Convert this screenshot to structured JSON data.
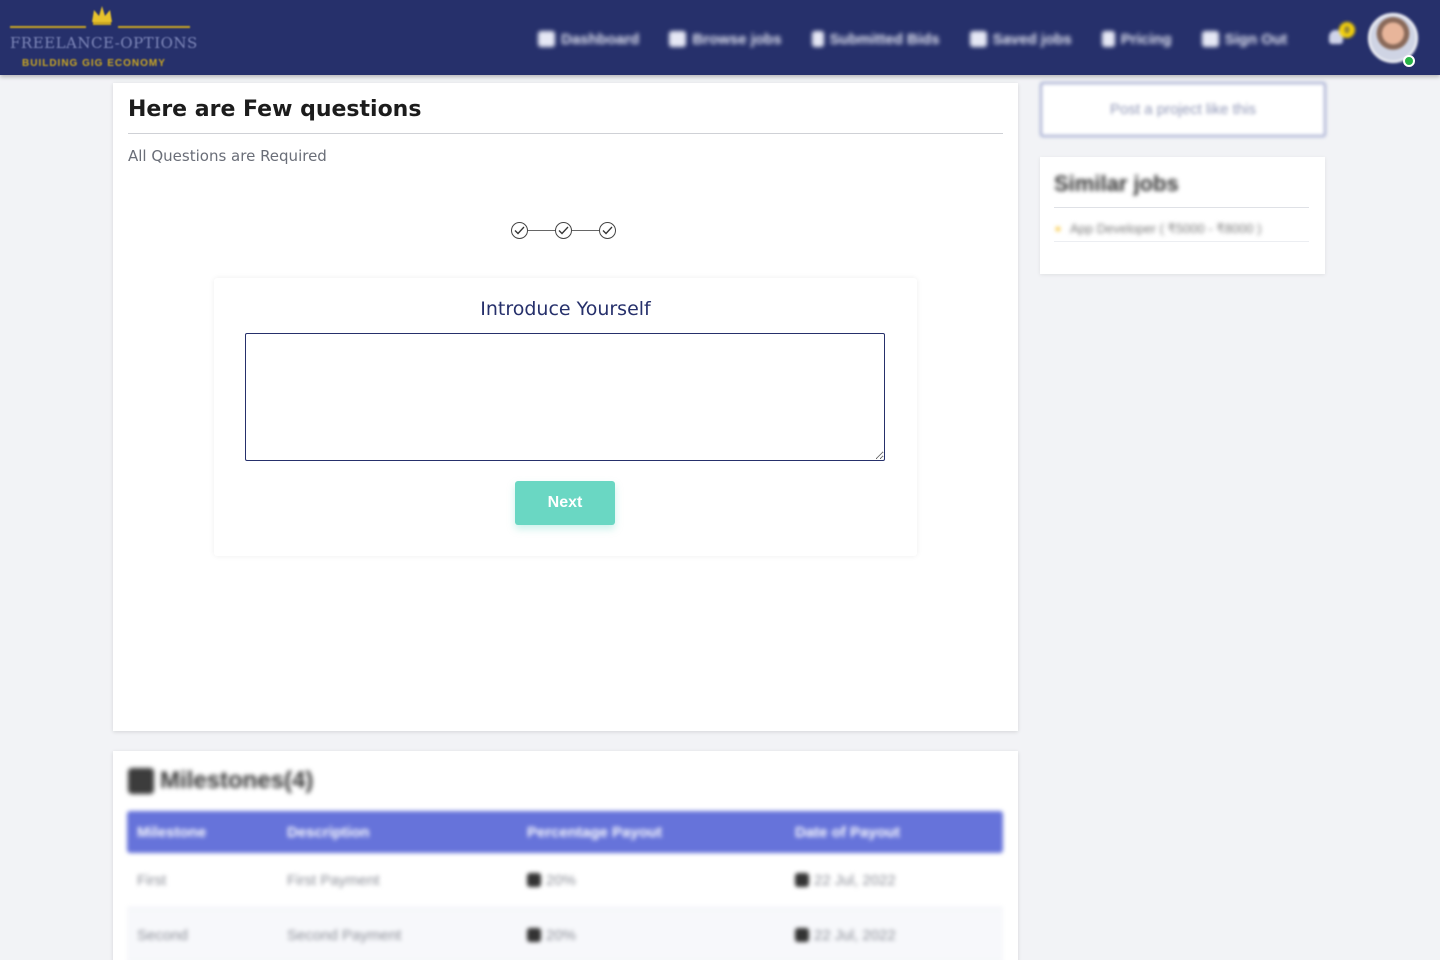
{
  "brand": {
    "name": "FREELANCE-OPTIONS",
    "tagline": "BUILDING GIG ECONOMY",
    "accent_color": "#c9a623",
    "navbar_color": "#26306b"
  },
  "nav": {
    "items": [
      {
        "label": "Dashboard",
        "icon": "home-icon"
      },
      {
        "label": "Browse jobs",
        "icon": "edit-icon"
      },
      {
        "label": "Submitted Bids",
        "icon": "document-icon"
      },
      {
        "label": "Saved jobs",
        "icon": "star-icon"
      },
      {
        "label": "Pricing",
        "icon": "receipt-icon"
      },
      {
        "label": "Sign Out",
        "icon": "sign-out-icon"
      }
    ],
    "notification_count": "0"
  },
  "questions": {
    "title": "Here are Few questions",
    "subtitle": "All Questions are Required",
    "steps_completed": 3,
    "steps_total": 3,
    "current_question": "Introduce Yourself",
    "answer_value": "",
    "next_label": "Next",
    "next_color": "#6ad7c3"
  },
  "milestones": {
    "title": "Milestones(4)",
    "header_color": "#6673da",
    "columns": [
      "Milestone",
      "Description",
      "Percentage Payout",
      "Date of Payout"
    ],
    "rows": [
      [
        "First",
        "First Payment",
        "20%",
        "22 Jul, 2022"
      ],
      [
        "Second",
        "Second Payment",
        "20%",
        "22 Jul, 2022"
      ]
    ]
  },
  "sidebar": {
    "post_label": "Post a project like this",
    "similar_title": "Similar jobs",
    "similar_items": [
      {
        "label": "App Developer ( ₹5000 - ₹8000 )"
      }
    ]
  }
}
